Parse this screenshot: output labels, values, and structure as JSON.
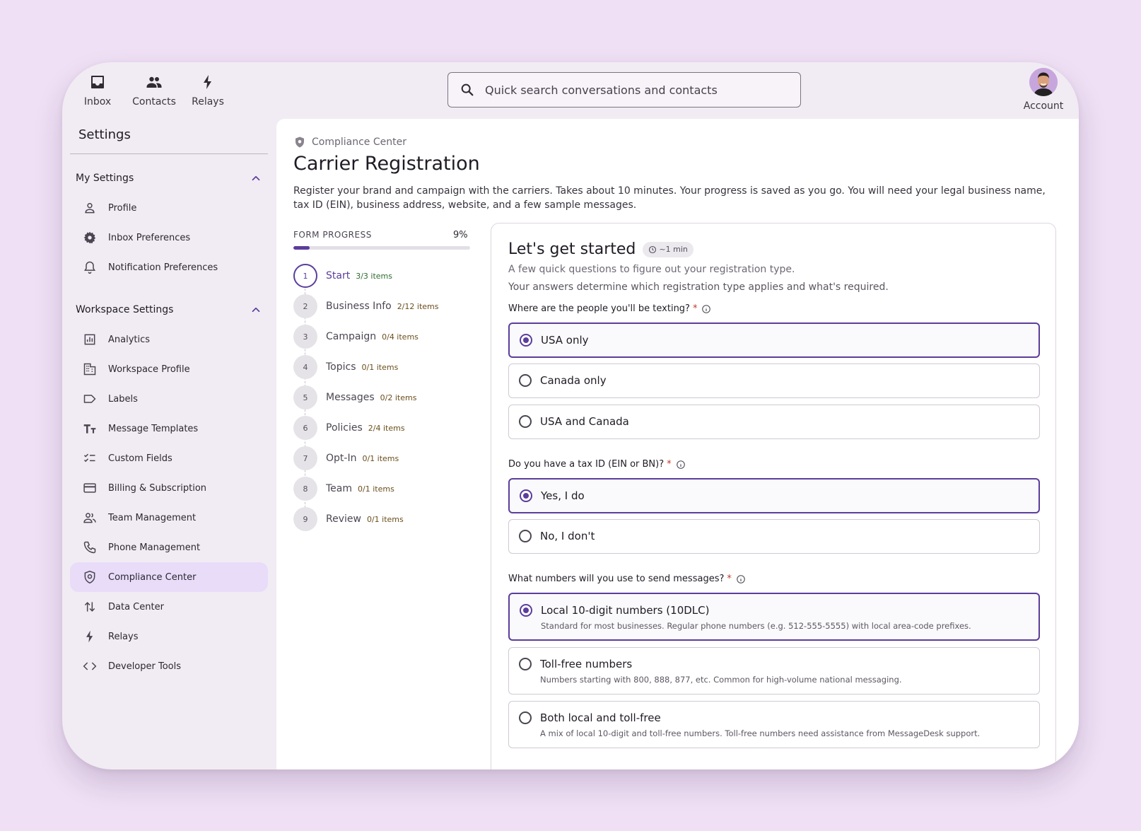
{
  "topnav": {
    "inbox": "Inbox",
    "contacts": "Contacts",
    "relays": "Relays",
    "account": "Account"
  },
  "search": {
    "placeholder": "Quick search conversations and contacts"
  },
  "sidebar": {
    "title": "Settings",
    "my_settings": {
      "label": "My Settings",
      "items": [
        "Profile",
        "Inbox Preferences",
        "Notification Preferences"
      ]
    },
    "workspace_settings": {
      "label": "Workspace Settings",
      "items": [
        "Analytics",
        "Workspace Profile",
        "Labels",
        "Message Templates",
        "Custom Fields",
        "Billing & Subscription",
        "Team Management",
        "Phone Management",
        "Compliance Center",
        "Data Center",
        "Relays",
        "Developer Tools"
      ]
    },
    "active_item": "Compliance Center"
  },
  "page": {
    "breadcrumb": "Compliance Center",
    "title": "Carrier Registration",
    "description": "Register your brand and campaign with the carriers. Takes about 10 minutes. Your progress is saved as you go. You will need your legal business name, tax ID (EIN), business address, website, and a few sample messages."
  },
  "progress": {
    "label": "FORM PROGRESS",
    "percent_label": "9%",
    "percent": 9
  },
  "steps": [
    {
      "num": "1",
      "name": "Start",
      "count": "3/3 items"
    },
    {
      "num": "2",
      "name": "Business Info",
      "count": "2/12 items"
    },
    {
      "num": "3",
      "name": "Campaign",
      "count": "0/4 items"
    },
    {
      "num": "4",
      "name": "Topics",
      "count": "0/1 items"
    },
    {
      "num": "5",
      "name": "Messages",
      "count": "0/2 items"
    },
    {
      "num": "6",
      "name": "Policies",
      "count": "2/4 items"
    },
    {
      "num": "7",
      "name": "Opt-In",
      "count": "0/1 items"
    },
    {
      "num": "8",
      "name": "Team",
      "count": "0/1 items"
    },
    {
      "num": "9",
      "name": "Review",
      "count": "0/1 items"
    }
  ],
  "form": {
    "heading": "Let's get started",
    "time_badge": "~1 min",
    "subtitle": "A few quick questions to figure out your registration type.",
    "note": "Your answers determine which registration type applies and what's required.",
    "q1": {
      "label": "Where are the people you'll be texting?",
      "options": [
        "USA only",
        "Canada only",
        "USA and Canada"
      ]
    },
    "q2": {
      "label": "Do you have a tax ID (EIN or BN)?",
      "options": [
        "Yes, I do",
        "No, I don't"
      ]
    },
    "q3": {
      "label": "What numbers will you use to send messages?",
      "options": [
        {
          "title": "Local 10-digit numbers (10DLC)",
          "desc": "Standard for most businesses. Regular phone numbers (e.g. 512-555-5555) with local area-code prefixes."
        },
        {
          "title": "Toll-free numbers",
          "desc": "Numbers starting with 800, 888, 877, etc. Common for high-volume national messaging."
        },
        {
          "title": "Both local and toll-free",
          "desc": "A mix of local 10-digit and toll-free numbers. Toll-free numbers need assistance from MessageDesk support."
        }
      ]
    },
    "required_mark": "*"
  },
  "colors": {
    "accent": "#5b3d9c",
    "active_bg": "#e8dcf9",
    "page_bg": "#efe0f5"
  }
}
